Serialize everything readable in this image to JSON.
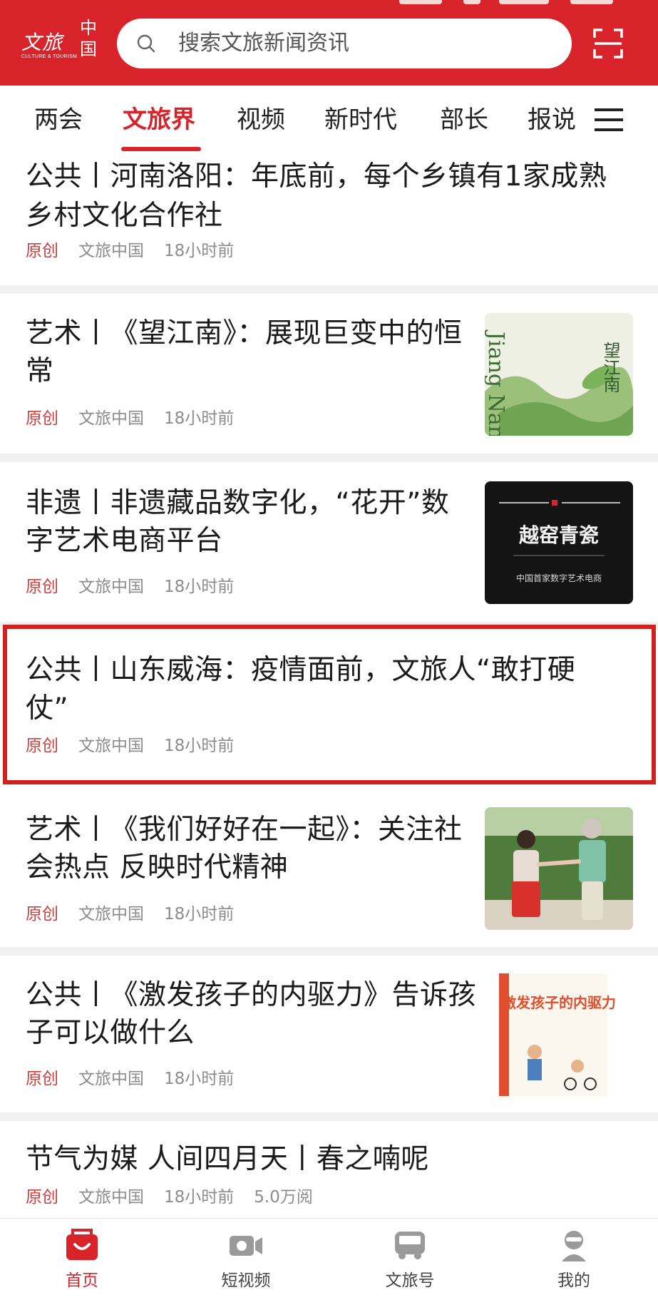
{
  "header": {
    "logo_text": "文旅",
    "logo_china": "中国",
    "logo_en": "CULTURE & TOURISM",
    "search_placeholder": "搜索文旅新闻资讯",
    "brand_color": "#d9232a"
  },
  "tabs": [
    {
      "label": "两会",
      "active": false
    },
    {
      "label": "文旅界",
      "active": true
    },
    {
      "label": "视频",
      "active": false
    },
    {
      "label": "新时代",
      "active": false
    },
    {
      "label": "部长",
      "active": false
    },
    {
      "label": "报说",
      "active": false
    }
  ],
  "articles": [
    {
      "title_line1": "公共丨河南洛阳：年底前，每个乡镇有1家成熟",
      "title_line2": "乡村文化合作社",
      "tag": "原创",
      "source": "文旅中国",
      "time": "18小时前"
    },
    {
      "title_line1": "艺术丨《望江南》：展现巨变中的恒",
      "title_line2": "常",
      "tag": "原创",
      "source": "文旅中国",
      "time": "18小时前",
      "thumb_text": "望江南",
      "thumb_subtitle": "Jiang Nan"
    },
    {
      "title_line1": "非遗丨非遗藏品数字化，“花开”数",
      "title_line2": "字艺术电商平台",
      "tag": "原创",
      "source": "文旅中国",
      "time": "18小时前",
      "thumb_text": "越窑青瓷",
      "thumb_subtitle": "中国首家数字艺术电商"
    },
    {
      "title_line1": "公共丨山东威海：疫情面前，文旅人“敢打硬",
      "title_line2": "仗”",
      "tag": "原创",
      "source": "文旅中国",
      "time": "18小时前"
    },
    {
      "title_line1": "艺术丨《我们好好在一起》：关注社",
      "title_line2": "会热点 反映时代精神",
      "tag": "原创",
      "source": "文旅中国",
      "time": "18小时前"
    },
    {
      "title_line1": "公共丨《激发孩子的内驱力》告诉孩",
      "title_line2": "子可以做什么",
      "tag": "原创",
      "source": "文旅中国",
      "time": "18小时前",
      "thumb_text": "激发孩子的内驱力"
    },
    {
      "title_line1": "节气为媒 人间四月天丨春之喃呢",
      "tag": "原创",
      "source": "文旅中国",
      "time": "18小时前",
      "views": "5.0万阅"
    }
  ],
  "bottom_nav": [
    {
      "label": "首页",
      "icon": "home-icon",
      "active": true
    },
    {
      "label": "短视频",
      "icon": "video-camera-icon",
      "active": false
    },
    {
      "label": "文旅号",
      "icon": "bus-icon",
      "active": false
    },
    {
      "label": "我的",
      "icon": "profile-icon",
      "active": false
    }
  ]
}
